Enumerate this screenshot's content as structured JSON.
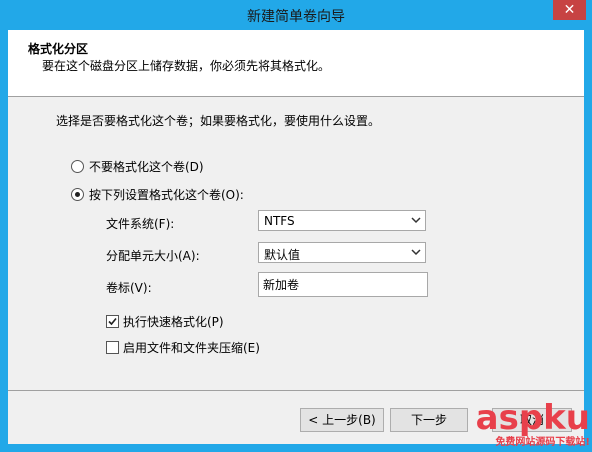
{
  "window": {
    "title": "新建简单卷向导",
    "close_glyph": "✕"
  },
  "header": {
    "title": "格式化分区",
    "subtitle": "要在这个磁盘分区上储存数据，你必须先将其格式化。"
  },
  "body": {
    "intro": "选择是否要格式化这个卷；如果要格式化，要使用什么设置。",
    "options": [
      {
        "label": "不要格式化这个卷(D)",
        "selected": false
      },
      {
        "label": "按下列设置格式化这个卷(O):",
        "selected": true
      }
    ],
    "fields": {
      "filesystem": {
        "label": "文件系统(F):",
        "value": "NTFS"
      },
      "allocation": {
        "label": "分配单元大小(A):",
        "value": "默认值"
      },
      "volume_label": {
        "label": "卷标(V):",
        "value": "新加卷"
      }
    },
    "checkboxes": [
      {
        "label": "执行快速格式化(P)",
        "checked": true
      },
      {
        "label": "启用文件和文件夹压缩(E)",
        "checked": false
      }
    ]
  },
  "buttons": {
    "back": "< 上一步(B)",
    "next": "下一步",
    "cancel": "取消"
  },
  "watermark": {
    "logo": "aspku",
    "tagline": "免费网站源码下载站!"
  },
  "colors": {
    "titlebar": "#22a8e8",
    "close": "#c74343",
    "watermark": "#e8404b"
  }
}
